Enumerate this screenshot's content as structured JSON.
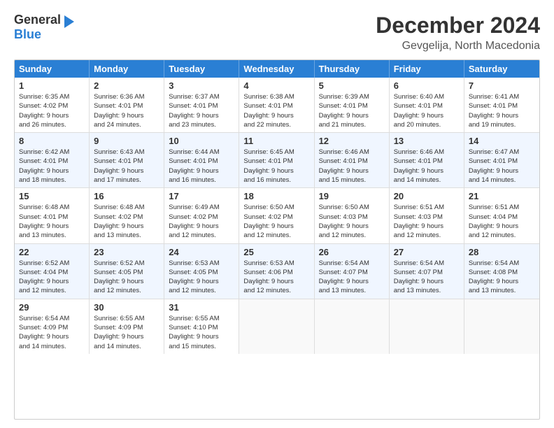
{
  "logo": {
    "general": "General",
    "blue": "Blue"
  },
  "title": "December 2024",
  "subtitle": "Gevgelija, North Macedonia",
  "days_of_week": [
    "Sunday",
    "Monday",
    "Tuesday",
    "Wednesday",
    "Thursday",
    "Friday",
    "Saturday"
  ],
  "weeks": [
    [
      {
        "day": "1",
        "lines": [
          "Sunrise: 6:35 AM",
          "Sunset: 4:02 PM",
          "Daylight: 9 hours",
          "and 26 minutes."
        ]
      },
      {
        "day": "2",
        "lines": [
          "Sunrise: 6:36 AM",
          "Sunset: 4:01 PM",
          "Daylight: 9 hours",
          "and 24 minutes."
        ]
      },
      {
        "day": "3",
        "lines": [
          "Sunrise: 6:37 AM",
          "Sunset: 4:01 PM",
          "Daylight: 9 hours",
          "and 23 minutes."
        ]
      },
      {
        "day": "4",
        "lines": [
          "Sunrise: 6:38 AM",
          "Sunset: 4:01 PM",
          "Daylight: 9 hours",
          "and 22 minutes."
        ]
      },
      {
        "day": "5",
        "lines": [
          "Sunrise: 6:39 AM",
          "Sunset: 4:01 PM",
          "Daylight: 9 hours",
          "and 21 minutes."
        ]
      },
      {
        "day": "6",
        "lines": [
          "Sunrise: 6:40 AM",
          "Sunset: 4:01 PM",
          "Daylight: 9 hours",
          "and 20 minutes."
        ]
      },
      {
        "day": "7",
        "lines": [
          "Sunrise: 6:41 AM",
          "Sunset: 4:01 PM",
          "Daylight: 9 hours",
          "and 19 minutes."
        ]
      }
    ],
    [
      {
        "day": "8",
        "lines": [
          "Sunrise: 6:42 AM",
          "Sunset: 4:01 PM",
          "Daylight: 9 hours",
          "and 18 minutes."
        ]
      },
      {
        "day": "9",
        "lines": [
          "Sunrise: 6:43 AM",
          "Sunset: 4:01 PM",
          "Daylight: 9 hours",
          "and 17 minutes."
        ]
      },
      {
        "day": "10",
        "lines": [
          "Sunrise: 6:44 AM",
          "Sunset: 4:01 PM",
          "Daylight: 9 hours",
          "and 16 minutes."
        ]
      },
      {
        "day": "11",
        "lines": [
          "Sunrise: 6:45 AM",
          "Sunset: 4:01 PM",
          "Daylight: 9 hours",
          "and 16 minutes."
        ]
      },
      {
        "day": "12",
        "lines": [
          "Sunrise: 6:46 AM",
          "Sunset: 4:01 PM",
          "Daylight: 9 hours",
          "and 15 minutes."
        ]
      },
      {
        "day": "13",
        "lines": [
          "Sunrise: 6:46 AM",
          "Sunset: 4:01 PM",
          "Daylight: 9 hours",
          "and 14 minutes."
        ]
      },
      {
        "day": "14",
        "lines": [
          "Sunrise: 6:47 AM",
          "Sunset: 4:01 PM",
          "Daylight: 9 hours",
          "and 14 minutes."
        ]
      }
    ],
    [
      {
        "day": "15",
        "lines": [
          "Sunrise: 6:48 AM",
          "Sunset: 4:01 PM",
          "Daylight: 9 hours",
          "and 13 minutes."
        ]
      },
      {
        "day": "16",
        "lines": [
          "Sunrise: 6:48 AM",
          "Sunset: 4:02 PM",
          "Daylight: 9 hours",
          "and 13 minutes."
        ]
      },
      {
        "day": "17",
        "lines": [
          "Sunrise: 6:49 AM",
          "Sunset: 4:02 PM",
          "Daylight: 9 hours",
          "and 12 minutes."
        ]
      },
      {
        "day": "18",
        "lines": [
          "Sunrise: 6:50 AM",
          "Sunset: 4:02 PM",
          "Daylight: 9 hours",
          "and 12 minutes."
        ]
      },
      {
        "day": "19",
        "lines": [
          "Sunrise: 6:50 AM",
          "Sunset: 4:03 PM",
          "Daylight: 9 hours",
          "and 12 minutes."
        ]
      },
      {
        "day": "20",
        "lines": [
          "Sunrise: 6:51 AM",
          "Sunset: 4:03 PM",
          "Daylight: 9 hours",
          "and 12 minutes."
        ]
      },
      {
        "day": "21",
        "lines": [
          "Sunrise: 6:51 AM",
          "Sunset: 4:04 PM",
          "Daylight: 9 hours",
          "and 12 minutes."
        ]
      }
    ],
    [
      {
        "day": "22",
        "lines": [
          "Sunrise: 6:52 AM",
          "Sunset: 4:04 PM",
          "Daylight: 9 hours",
          "and 12 minutes."
        ]
      },
      {
        "day": "23",
        "lines": [
          "Sunrise: 6:52 AM",
          "Sunset: 4:05 PM",
          "Daylight: 9 hours",
          "and 12 minutes."
        ]
      },
      {
        "day": "24",
        "lines": [
          "Sunrise: 6:53 AM",
          "Sunset: 4:05 PM",
          "Daylight: 9 hours",
          "and 12 minutes."
        ]
      },
      {
        "day": "25",
        "lines": [
          "Sunrise: 6:53 AM",
          "Sunset: 4:06 PM",
          "Daylight: 9 hours",
          "and 12 minutes."
        ]
      },
      {
        "day": "26",
        "lines": [
          "Sunrise: 6:54 AM",
          "Sunset: 4:07 PM",
          "Daylight: 9 hours",
          "and 13 minutes."
        ]
      },
      {
        "day": "27",
        "lines": [
          "Sunrise: 6:54 AM",
          "Sunset: 4:07 PM",
          "Daylight: 9 hours",
          "and 13 minutes."
        ]
      },
      {
        "day": "28",
        "lines": [
          "Sunrise: 6:54 AM",
          "Sunset: 4:08 PM",
          "Daylight: 9 hours",
          "and 13 minutes."
        ]
      }
    ],
    [
      {
        "day": "29",
        "lines": [
          "Sunrise: 6:54 AM",
          "Sunset: 4:09 PM",
          "Daylight: 9 hours",
          "and 14 minutes."
        ]
      },
      {
        "day": "30",
        "lines": [
          "Sunrise: 6:55 AM",
          "Sunset: 4:09 PM",
          "Daylight: 9 hours",
          "and 14 minutes."
        ]
      },
      {
        "day": "31",
        "lines": [
          "Sunrise: 6:55 AM",
          "Sunset: 4:10 PM",
          "Daylight: 9 hours",
          "and 15 minutes."
        ]
      },
      {
        "day": "",
        "lines": []
      },
      {
        "day": "",
        "lines": []
      },
      {
        "day": "",
        "lines": []
      },
      {
        "day": "",
        "lines": []
      }
    ]
  ]
}
